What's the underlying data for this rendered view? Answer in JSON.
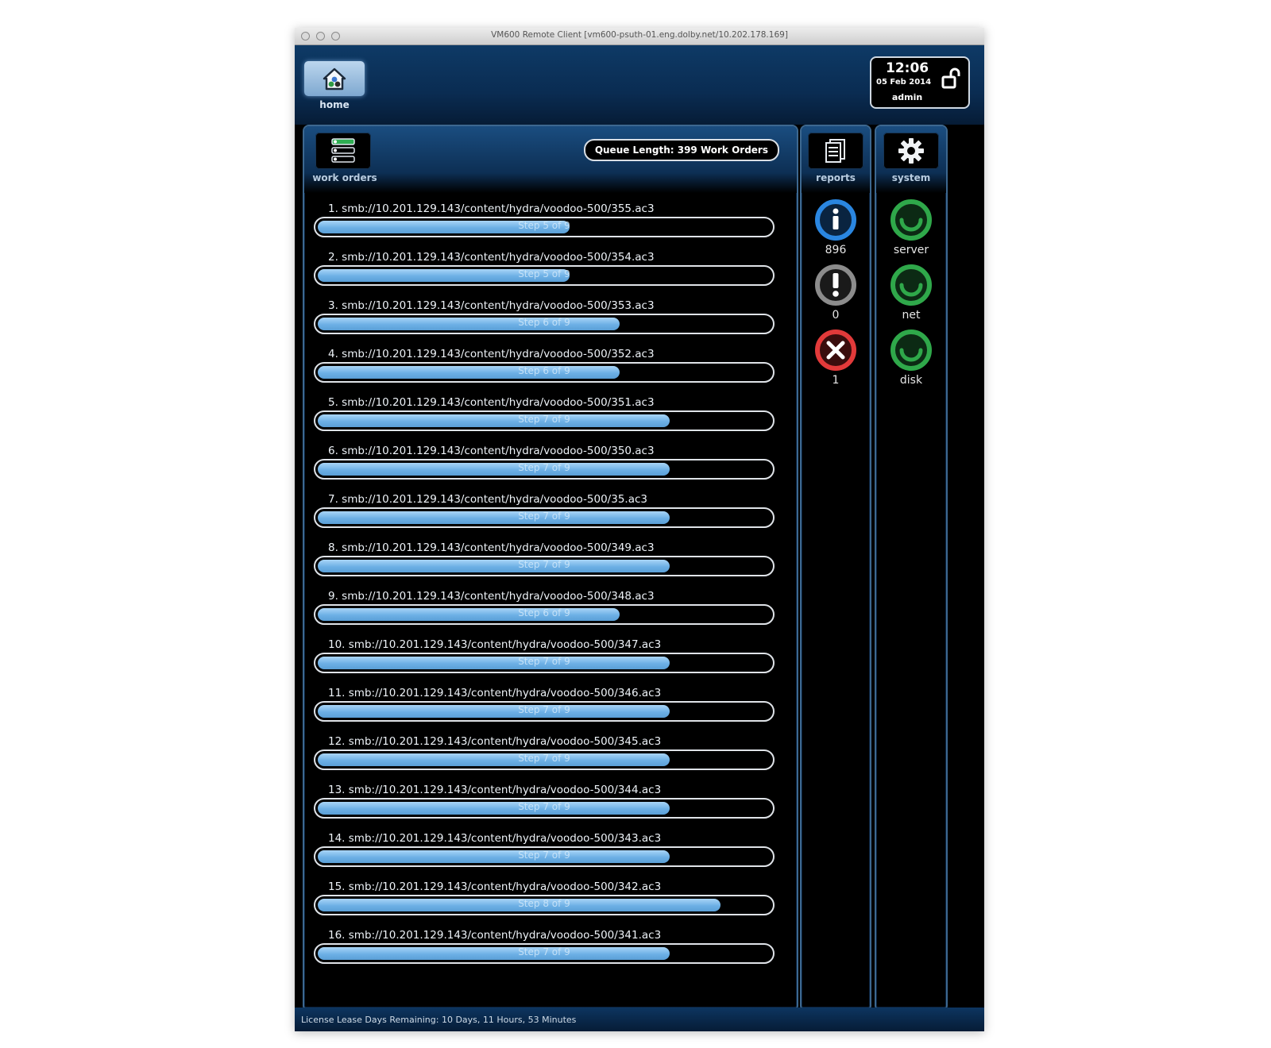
{
  "window": {
    "title": "VM600 Remote Client [vm600-psuth-01.eng.dolby.net/10.202.178.169]"
  },
  "header": {
    "home_label": "home",
    "clock": {
      "time": "12:06",
      "date": "05 Feb 2014",
      "user": "admin"
    }
  },
  "work_orders": {
    "label": "work orders",
    "queue_text": "Queue Length: 399 Work Orders",
    "items": [
      {
        "path": "1. smb://10.201.129.143/content/hydra/voodoo-500/355.ac3",
        "step": "Step 5 of 9",
        "progress": 0.5556
      },
      {
        "path": "2. smb://10.201.129.143/content/hydra/voodoo-500/354.ac3",
        "step": "Step 5 of 9",
        "progress": 0.5556
      },
      {
        "path": "3. smb://10.201.129.143/content/hydra/voodoo-500/353.ac3",
        "step": "Step 6 of 9",
        "progress": 0.6667
      },
      {
        "path": "4. smb://10.201.129.143/content/hydra/voodoo-500/352.ac3",
        "step": "Step 6 of 9",
        "progress": 0.6667
      },
      {
        "path": "5. smb://10.201.129.143/content/hydra/voodoo-500/351.ac3",
        "step": "Step 7 of 9",
        "progress": 0.7778
      },
      {
        "path": "6. smb://10.201.129.143/content/hydra/voodoo-500/350.ac3",
        "step": "Step 7 of 9",
        "progress": 0.7778
      },
      {
        "path": "7. smb://10.201.129.143/content/hydra/voodoo-500/35.ac3",
        "step": "Step 7 of 9",
        "progress": 0.7778
      },
      {
        "path": "8. smb://10.201.129.143/content/hydra/voodoo-500/349.ac3",
        "step": "Step 7 of 9",
        "progress": 0.7778
      },
      {
        "path": "9. smb://10.201.129.143/content/hydra/voodoo-500/348.ac3",
        "step": "Step 6 of 9",
        "progress": 0.6667
      },
      {
        "path": "10. smb://10.201.129.143/content/hydra/voodoo-500/347.ac3",
        "step": "Step 7 of 9",
        "progress": 0.7778
      },
      {
        "path": "11. smb://10.201.129.143/content/hydra/voodoo-500/346.ac3",
        "step": "Step 7 of 9",
        "progress": 0.7778
      },
      {
        "path": "12. smb://10.201.129.143/content/hydra/voodoo-500/345.ac3",
        "step": "Step 7 of 9",
        "progress": 0.7778
      },
      {
        "path": "13. smb://10.201.129.143/content/hydra/voodoo-500/344.ac3",
        "step": "Step 7 of 9",
        "progress": 0.7778
      },
      {
        "path": "14. smb://10.201.129.143/content/hydra/voodoo-500/343.ac3",
        "step": "Step 7 of 9",
        "progress": 0.7778
      },
      {
        "path": "15. smb://10.201.129.143/content/hydra/voodoo-500/342.ac3",
        "step": "Step 8 of 9",
        "progress": 0.8889
      },
      {
        "path": "16. smb://10.201.129.143/content/hydra/voodoo-500/341.ac3",
        "step": "Step 7 of 9",
        "progress": 0.7778
      }
    ]
  },
  "reports": {
    "label": "reports",
    "info": {
      "icon": "info-icon",
      "count": "896",
      "color": "#1f7ad6"
    },
    "warning": {
      "icon": "warning-icon",
      "count": "0",
      "color": "#8a8a8a"
    },
    "error": {
      "icon": "error-icon",
      "count": "1",
      "color": "#e23a3a"
    }
  },
  "system": {
    "label": "system",
    "server": {
      "icon": "status-ok-icon",
      "label": "server",
      "color": "#2fa84a"
    },
    "net": {
      "icon": "status-ok-icon",
      "label": "net",
      "color": "#2fa84a"
    },
    "disk": {
      "icon": "status-ok-icon",
      "label": "disk",
      "color": "#2fa84a"
    }
  },
  "footer": {
    "license_text": "License Lease Days Remaining: 10 Days, 11 Hours, 53 Minutes"
  }
}
